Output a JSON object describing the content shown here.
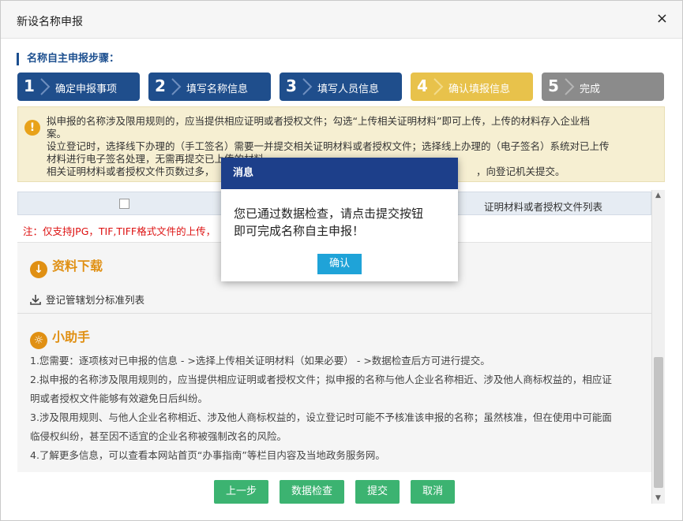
{
  "window": {
    "title": "新设名称申报",
    "close": "×"
  },
  "steps": {
    "heading": "名称自主申报步骤：",
    "items": [
      {
        "num": "1",
        "label": "确定申报事项"
      },
      {
        "num": "2",
        "label": "填写名称信息"
      },
      {
        "num": "3",
        "label": "填写人员信息"
      },
      {
        "num": "4",
        "label": "确认填报信息"
      },
      {
        "num": "5",
        "label": "完成"
      }
    ]
  },
  "notice": {
    "icon": "!",
    "lines": [
      "拟申报的名称涉及限用规则的，应当提供相应证明或者授权文件；勾选“上传相关证明材料”即可上传，上传的材料存入企业档",
      "案。",
      "设立登记时，选择线下办理的（手工签名）需要一并提交相关证明材料或者授权文件；选择线上办理的（电子签名）系统对已上传",
      "材料进行电子签名处理，无需再提交已上传的材料。",
      "相关证明材料或者授权文件页数过多，",
      "，向登记机关提交。"
    ]
  },
  "table": {
    "col2": "证明材料或者授权文件列表"
  },
  "note": "注：仅支持JPG，TIF,TIFF格式文件的上传，",
  "download": {
    "title": "资料下载",
    "link": "登记管辖划分标准列表"
  },
  "helper": {
    "title": "小助手",
    "lines": [
      "1.您需要：逐项核对已申报的信息 - >选择上传相关证明材料（如果必要） - >数据检查后方可进行提交。",
      "2.拟申报的名称涉及限用规则的，应当提供相应证明或者授权文件；拟申报的名称与他人企业名称相近、涉及他人商标权益的，相应证",
      "明或者授权文件能够有效避免日后纠纷。",
      "3.涉及限用规则、与他人企业名称相近、涉及他人商标权益的，设立登记时可能不予核准该申报的名称；虽然核准，但在使用中可能面",
      "临侵权纠纷，甚至因不适宜的企业名称被强制改名的风险。",
      "4.了解更多信息，可以查看本网站首页“办事指南”等栏目内容及当地政务服务网。"
    ]
  },
  "buttons": {
    "prev": "上一步",
    "check": "数据检查",
    "submit": "提交",
    "cancel": "取消"
  },
  "dialog": {
    "title": "消息",
    "message_line1": "您已通过数据检查，请点击提交按钮",
    "message_line2": "即可完成名称自主申报！",
    "ok": "确认"
  },
  "colors": {
    "step_done": "#1f4e8c",
    "step_current": "#e8c24b",
    "step_pending": "#8b8b8b",
    "button": "#3cb371",
    "dialog_header": "#1d3f8a",
    "ok_button": "#1fa3d8"
  }
}
